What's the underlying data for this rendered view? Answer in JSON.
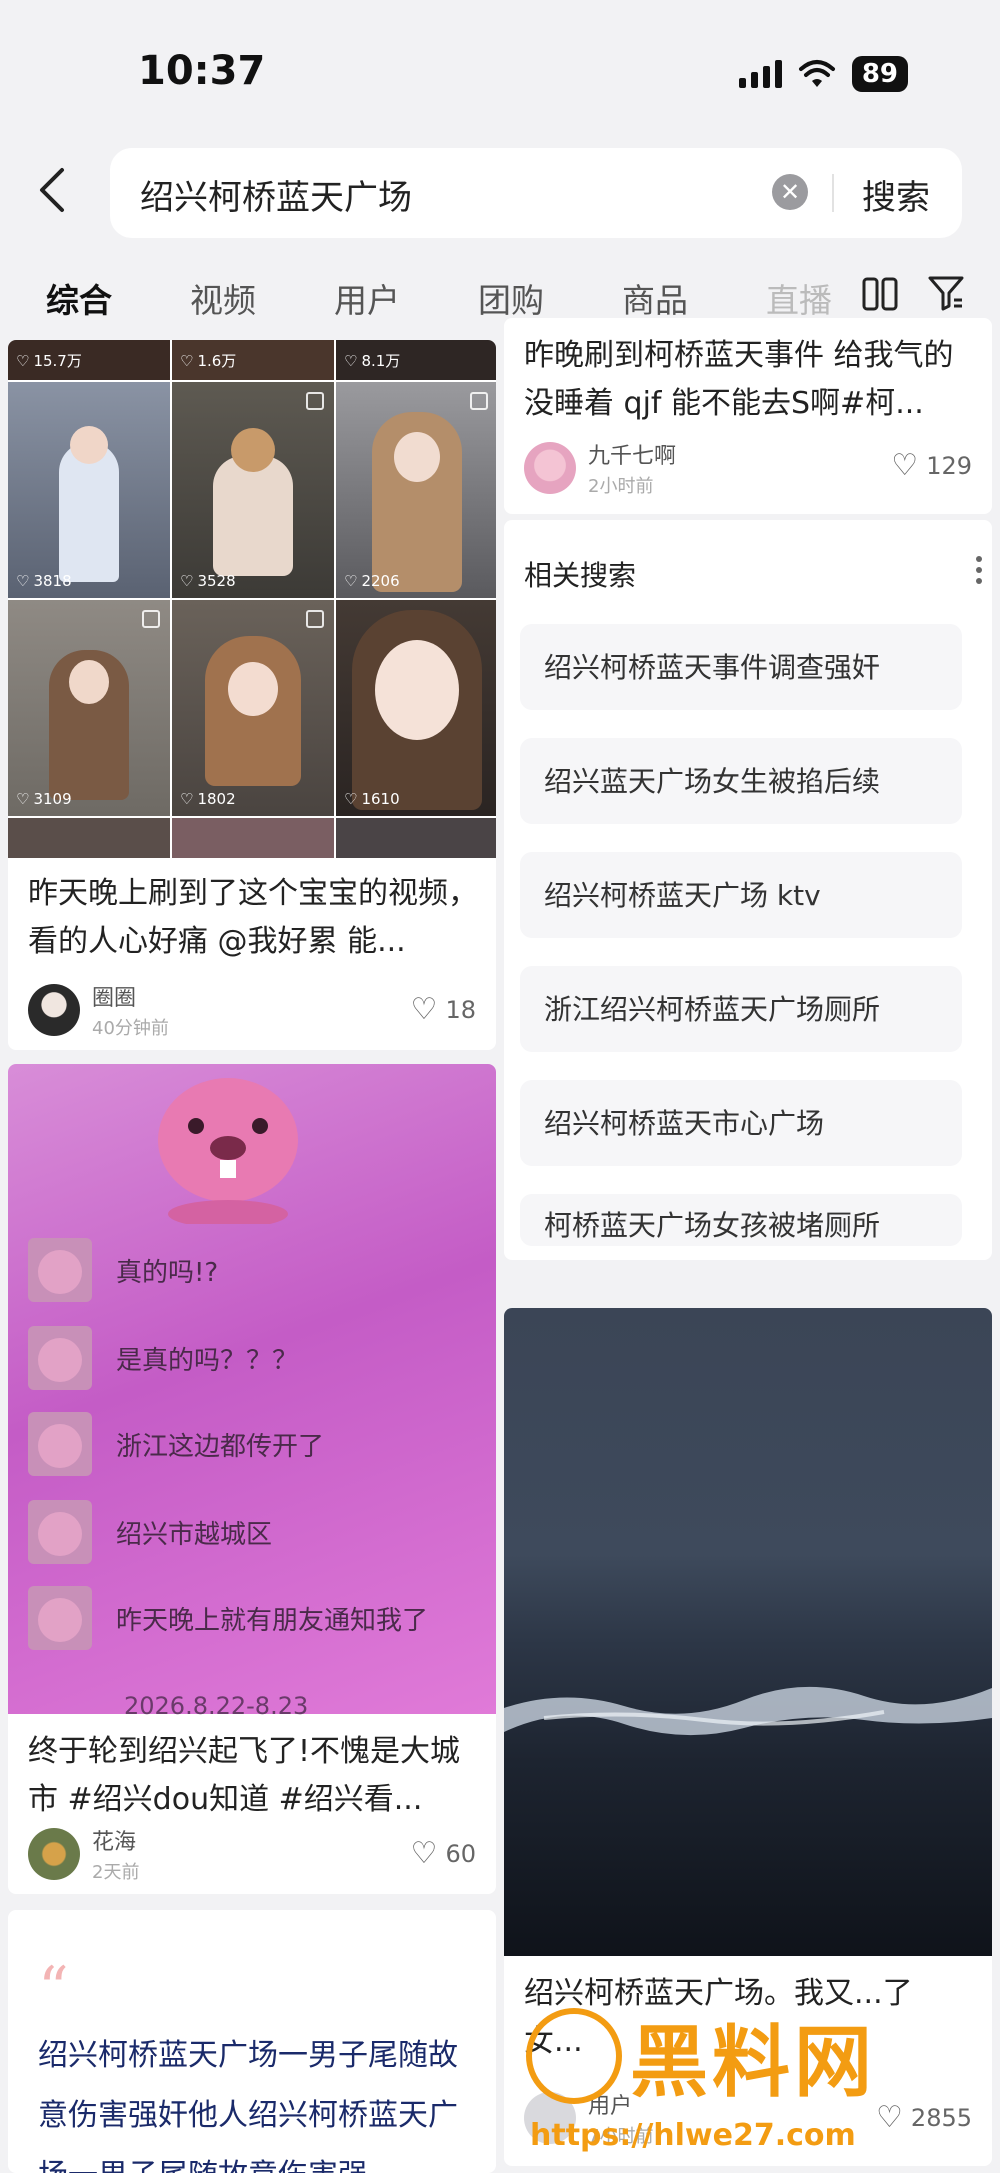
{
  "status_bar": {
    "time": "10:37",
    "battery": "89"
  },
  "search": {
    "query": "绍兴柯桥蓝天广场",
    "button": "搜索"
  },
  "tabs": [
    {
      "label": "综合"
    },
    {
      "label": "视频"
    },
    {
      "label": "用户"
    },
    {
      "label": "团购"
    },
    {
      "label": "商品"
    },
    {
      "label": "直播"
    }
  ],
  "video_grid": {
    "top_stats": [
      "15.7万",
      "1.6万",
      "8.1万"
    ],
    "mid_stats": [
      "3818",
      "3528",
      "2206"
    ],
    "low_stats": [
      "3109",
      "1802",
      "1610"
    ]
  },
  "cards": {
    "c1": {
      "title": "昨天晚上刷到了这个宝宝的视频，看的人心好痛 @我好累 能...",
      "author": "圈圈",
      "time": "40分钟前",
      "likes": "18"
    },
    "c2": {
      "title": "昨晚刷到柯桥蓝天事件 给我气的没睡着 qjf 能不能去S啊#柯...",
      "author": "九千七啊",
      "time": "2小时前",
      "likes": "129"
    },
    "c3": {
      "title": "终于轮到绍兴起飞了!不愧是大城市 #绍兴dou知道 #绍兴看...",
      "author": "花海",
      "time": "2天前",
      "likes": "60"
    },
    "c4": {
      "title": "绍兴柯桥蓝天广场。我又...了 女...",
      "author": "用户",
      "time": "7小时前",
      "likes": "2855"
    }
  },
  "chat": {
    "messages": [
      "真的吗!?",
      "是真的吗？？？",
      "浙江这边都传开了",
      "绍兴市越城区",
      "昨天晚上就有朋友通知我了"
    ],
    "date": "2026.8.22-8.23"
  },
  "related": {
    "title": "相关搜索",
    "items": [
      "绍兴柯桥蓝天事件调查强奸",
      "绍兴蓝天广场女生被掐后续",
      "绍兴柯桥蓝天广场 ktv",
      "浙江绍兴柯桥蓝天广场厕所",
      "绍兴柯桥蓝天市心广场",
      "柯桥蓝天广场女孩被堵厕所"
    ]
  },
  "quote_card": {
    "text": "绍兴柯桥蓝天广场一男子尾随故意伤害强奸他人绍兴柯桥蓝天广场一男子尾随故意伤害强"
  },
  "watermark": {
    "main": "黑料网",
    "url": "https://hlwe27.com"
  },
  "colors": {
    "accent": "#f39c12",
    "pink": "#c45cc6"
  }
}
